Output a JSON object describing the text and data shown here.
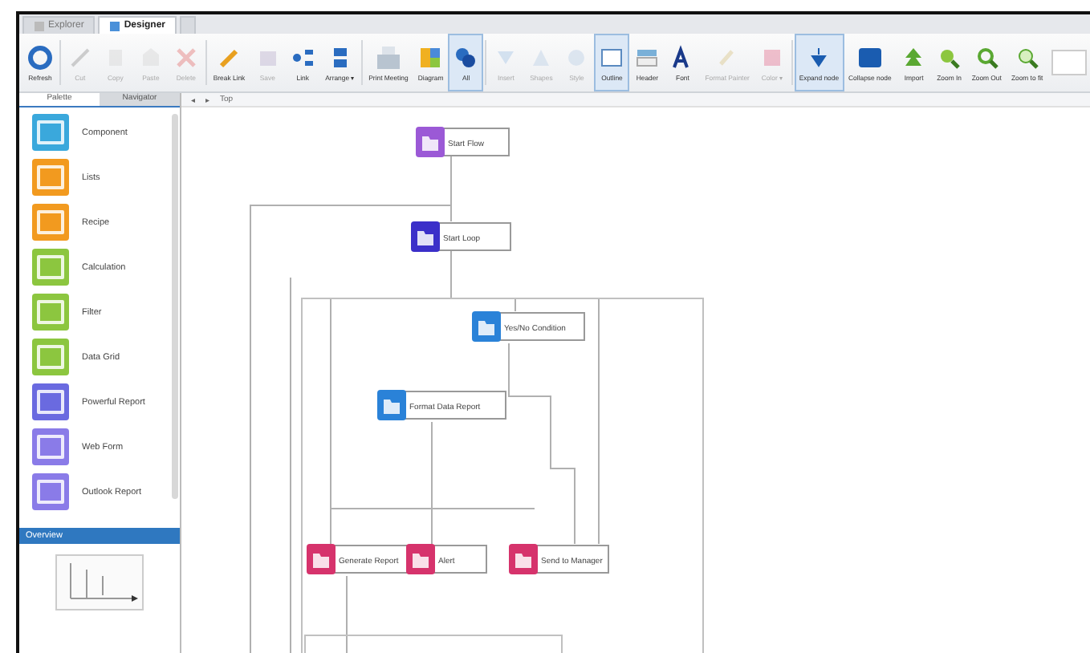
{
  "tabs": [
    {
      "label": "Explorer",
      "selected": false
    },
    {
      "label": "Designer",
      "selected": true
    }
  ],
  "toolbar": [
    {
      "label": "Refresh",
      "disabled": false,
      "selected": false
    },
    {
      "label": "Cut",
      "disabled": true,
      "selected": false
    },
    {
      "label": "Copy",
      "disabled": true,
      "selected": false
    },
    {
      "label": "Paste",
      "disabled": true,
      "selected": false
    },
    {
      "label": "Delete",
      "disabled": true,
      "selected": false
    },
    {
      "label": "Break Link",
      "disabled": false,
      "selected": false
    },
    {
      "label": "Save",
      "disabled": true,
      "selected": false
    },
    {
      "label": "Link",
      "disabled": false,
      "selected": false
    },
    {
      "label": "Arrange ▾",
      "disabled": false,
      "selected": false
    },
    {
      "label": "Print Meeting",
      "disabled": false,
      "selected": false
    },
    {
      "label": "Diagram",
      "disabled": false,
      "selected": false
    },
    {
      "label": "All",
      "disabled": false,
      "selected": true
    },
    {
      "label": "Insert",
      "disabled": true,
      "selected": false
    },
    {
      "label": "Shapes",
      "disabled": true,
      "selected": false
    },
    {
      "label": "Style",
      "disabled": true,
      "selected": false
    },
    {
      "label": "Outline",
      "disabled": false,
      "selected": true
    },
    {
      "label": "Header",
      "disabled": false,
      "selected": false
    },
    {
      "label": "Font",
      "disabled": false,
      "selected": false
    },
    {
      "label": "Format Painter",
      "disabled": true,
      "selected": false
    },
    {
      "label": "Color ▾",
      "disabled": true,
      "selected": false
    },
    {
      "label": "Expand node",
      "disabled": false,
      "selected": true
    },
    {
      "label": "Collapse node",
      "disabled": false,
      "selected": false
    },
    {
      "label": "Import",
      "disabled": false,
      "selected": false
    },
    {
      "label": "Zoom In",
      "disabled": false,
      "selected": false
    },
    {
      "label": "Zoom Out",
      "disabled": false,
      "selected": false
    },
    {
      "label": "Zoom to fit",
      "disabled": false,
      "selected": false
    }
  ],
  "side_tabs": [
    {
      "label": "Palette",
      "selected": true
    },
    {
      "label": "Navigator",
      "selected": false
    }
  ],
  "breadcrumb": [
    "◂",
    "▸",
    "Top"
  ],
  "palette": [
    {
      "label": "Component",
      "color": "#3aa8dc"
    },
    {
      "label": "Lists",
      "color": "#f29a1f"
    },
    {
      "label": "Recipe",
      "color": "#f29a1f"
    },
    {
      "label": "Calculation",
      "color": "#8cc63f"
    },
    {
      "label": "Filter",
      "color": "#8cc63f"
    },
    {
      "label": "Data Grid",
      "color": "#8cc63f"
    },
    {
      "label": "Powerful Report",
      "color": "#6a6ae0"
    },
    {
      "label": "Web Form",
      "color": "#8a7be8"
    },
    {
      "label": "Outlook Report",
      "color": "#8a7be8"
    }
  ],
  "overview": {
    "title": "Overview"
  },
  "nodes": [
    {
      "label": "Start Flow",
      "color": "#9b59d6"
    },
    {
      "label": "Start Loop",
      "color": "#3b2fc9"
    },
    {
      "label": "Yes/No Condition",
      "color": "#2a82d8"
    },
    {
      "label": "Format Data Report",
      "color": "#2a82d8"
    },
    {
      "label": "Generate Report",
      "color": "#d6336c"
    },
    {
      "label": "Alert",
      "color": "#d6336c"
    },
    {
      "label": "Send to Manager",
      "color": "#d6336c"
    }
  ]
}
